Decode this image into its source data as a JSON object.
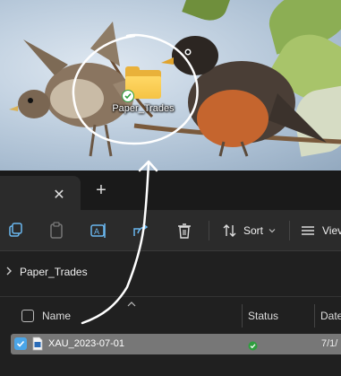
{
  "desktop": {
    "icon_label": "Paper_Trades",
    "icon": "folder-icon",
    "badge": "synced-check-icon"
  },
  "window": {
    "tab": {
      "close_glyph": "✕",
      "add_glyph": "+"
    },
    "toolbar": {
      "buttons": [
        "new-folder-icon",
        "copy-icon",
        "paste-icon",
        "rename-icon",
        "share-icon",
        "delete-icon"
      ],
      "sort_label": "Sort",
      "view_label": "Viev"
    },
    "breadcrumb": {
      "folder": "Paper_Trades"
    },
    "columns": {
      "name": "Name",
      "status": "Status",
      "date": "Date"
    },
    "files": [
      {
        "name": "XAU_2023-07-01",
        "status": "available-icon",
        "date": "7/1/",
        "selected": true
      }
    ]
  },
  "colors": {
    "accent": "#4aa5e8",
    "status_green": "#2e9e3e",
    "folder_yellow": "#f5c344",
    "selected_row": "#777777"
  }
}
